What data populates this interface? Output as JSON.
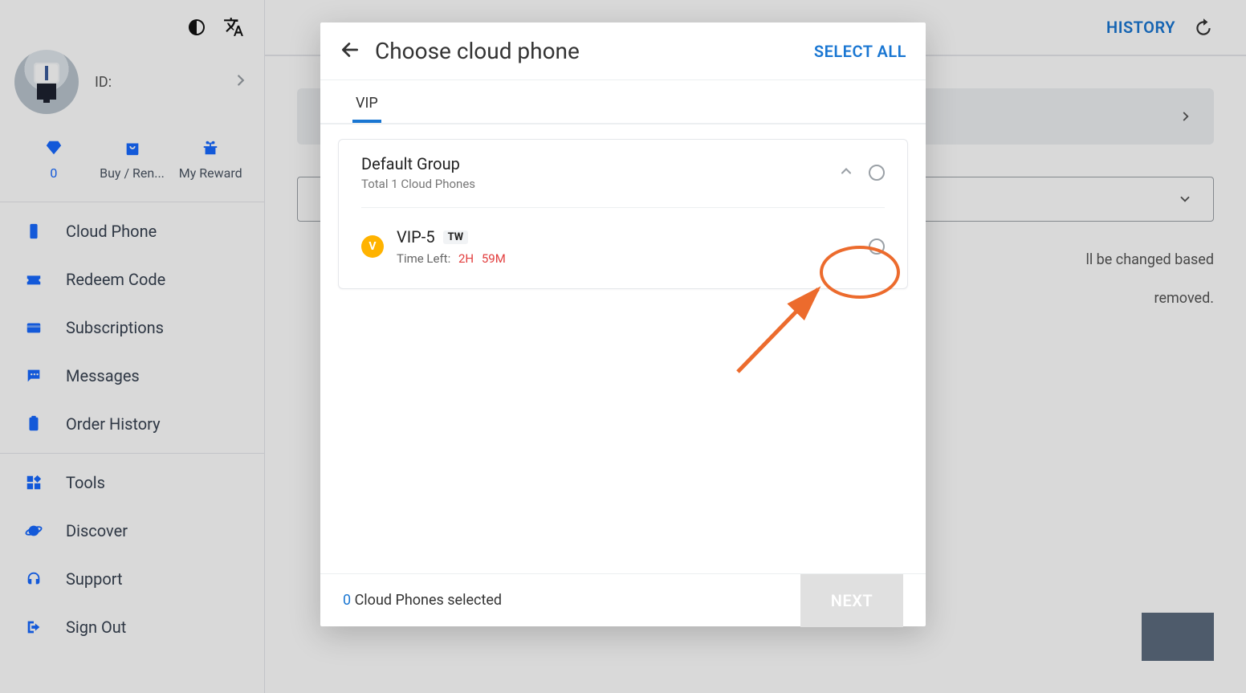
{
  "sidebar": {
    "id_label": "ID:",
    "actions": {
      "diamond_value": "0",
      "buy_label": "Buy / Ren...",
      "reward_label": "My Reward"
    },
    "nav": [
      {
        "label": "Cloud Phone"
      },
      {
        "label": "Redeem Code"
      },
      {
        "label": "Subscriptions"
      },
      {
        "label": "Messages"
      },
      {
        "label": "Order History"
      },
      {
        "label": "Tools"
      },
      {
        "label": "Discover"
      },
      {
        "label": "Support"
      },
      {
        "label": "Sign Out"
      }
    ]
  },
  "topbar": {
    "history": "HISTORY"
  },
  "hidden": {
    "line1": "ll be changed based",
    "line2": "removed."
  },
  "modal": {
    "title": "Choose cloud phone",
    "select_all": "SELECT ALL",
    "tab": "VIP",
    "group": {
      "name": "Default Group",
      "count_label": "Total 1 Cloud Phones"
    },
    "phone": {
      "name": "VIP-5",
      "region": "TW",
      "time_label": "Time Left:",
      "time_h": "2H",
      "time_m": "59M"
    },
    "footer": {
      "count": "0",
      "suffix": "Cloud Phones selected",
      "next": "NEXT"
    }
  }
}
